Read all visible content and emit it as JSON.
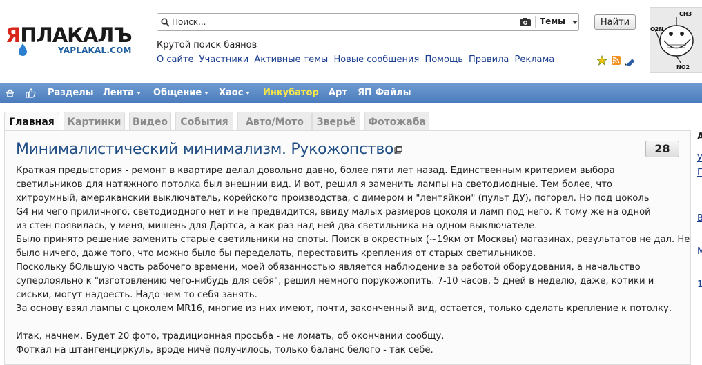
{
  "logo": {
    "text_red": "Я",
    "text_main": "ПЛАКАЛЪ",
    "subtitle": "YAPLAKAL.COM"
  },
  "search": {
    "placeholder": "Поиск...",
    "scope": "Темы",
    "button": "Найти"
  },
  "tagline": "Крутой поиск баянов",
  "toplinks": [
    "О сайте",
    "Участники",
    "Активные темы",
    "Новые сообщения",
    "Помощь",
    "Правила",
    "Реклама"
  ],
  "header_icons": [
    "star-icon",
    "rss-icon",
    "edit-icon"
  ],
  "avatar": {
    "top_label": "CH3",
    "left_label": "O2N",
    "bottom_label": "NO2"
  },
  "nav": {
    "items": [
      "Разделы",
      "Лента",
      "Общение",
      "Хаос",
      "Инкубатор",
      "Арт",
      "ЯП Файлы"
    ],
    "highlight_color": "#f5e64a"
  },
  "tabs": [
    "Главная",
    "Картинки",
    "Видео",
    "События",
    "Авто/Мото",
    "Зверьё",
    "Фотожаба"
  ],
  "post": {
    "title": "Минималистический минимализм. Рукожопство.",
    "count": "28",
    "lines": [
      "Краткая предыстория - ремонт в квартире делал довольно давно, более пяти лет назад. Единственным критерием выбора",
      "светильников для натяжного потолка был внешний вид. И вот, решил я заменить лампы на светодиодные. Тем более, что",
      "хитроумный, американский выключатель, корейского производства, с димером и \"лентяйкой\" (пульт ДУ), погорел. Но под цоколь",
      "G4 ни чего приличного, светодиодного нет и не предвидится, ввиду малых размеров цоколя и ламп под него. К тому же на одной",
      "из стен появилась, у меня, мишень для Дартса, а как раз над ней два светильника на одном выключателе.",
      "Было принято решение заменить старые светильники на споты. Поиск в окрестных (~19км от Москвы) магазинах, результатов не дал. Не",
      "было ничего, даже того, что можно было бы переделать, переставить крепления от старых светильников.",
      "Поскольку бОльшую часть рабочего времени, моей обязанностью является наблюдение за работой оборудования, а начальство",
      "суперлояльно к \"изготовлению чего-нибудь для себя\", решил немного порукожопить. 7-10 часов, 5 дней в неделю, даже, котики и",
      "сиськи, могут надоесть. Надо чем то себя занять.",
      "За основу взял лампы с цоколем MR16, многие из них имеют, почти, законченный вид, остается, только сделать крепление к потолку.",
      "",
      "Итак, начнем. Будет 20 фото, традиционная просьба - не ломать, об окончании сообщу.",
      "Фоткал на штангенциркуль, вроде ничё получилось, только баланс белого - так себе."
    ]
  },
  "right_column": [
    "А",
    "У",
    "П",
    "В",
    "М",
    "1"
  ]
}
